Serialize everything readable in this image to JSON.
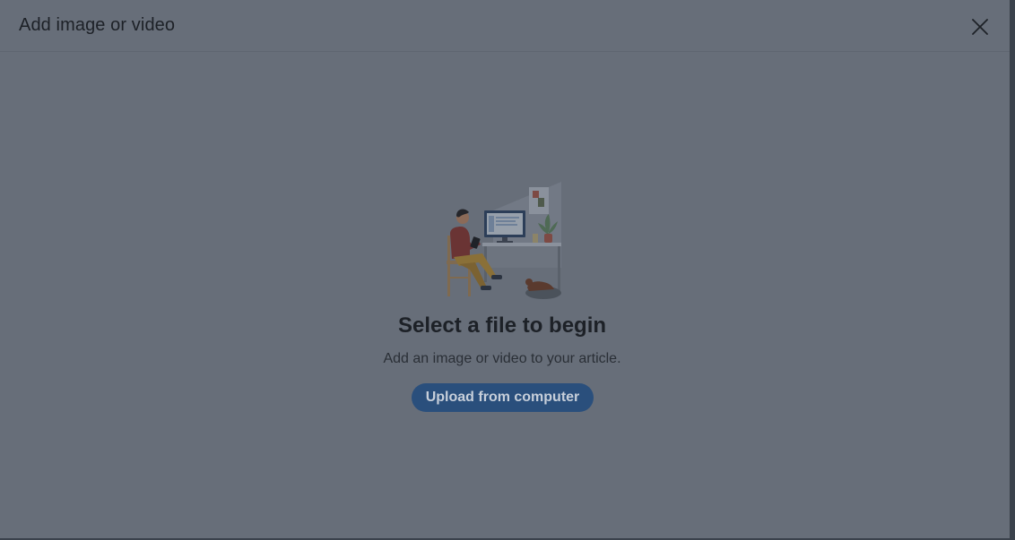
{
  "dialog": {
    "title": "Add image or video",
    "close_icon": "close-icon"
  },
  "empty_state": {
    "illustration": "person-at-desk-illustration",
    "title": "Select a file to begin",
    "subtitle": "Add an image or video to your article.",
    "upload_label": "Upload from computer"
  },
  "colors": {
    "overlay_background": "#676e79",
    "primary_button": "#2a4f7c",
    "text_primary": "#1d2127"
  }
}
